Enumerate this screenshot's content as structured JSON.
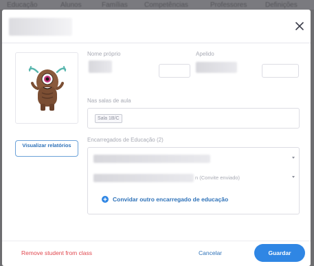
{
  "backdrop_nav": [
    "Educação",
    "Alunos",
    "Famílias",
    "Competências",
    "Professores",
    "Definições"
  ],
  "modal": {
    "close_icon": "close-icon",
    "avatar_icon": "monster-avatar-icon"
  },
  "form": {
    "first_name_label": "Nome próprio",
    "last_name_label": "Apelido",
    "classes_label": "Nas salas de aula",
    "class_chip": "Sala 1B/C",
    "guardians_label": "Encarregados de Educação (2)",
    "guardian_status": "n (Convite enviado)",
    "invite_label": "Convidar outro encarregado de educação"
  },
  "actions": {
    "view_reports": "Visualizar relatórios",
    "remove_student": "Remove student from class",
    "cancel": "Cancelar",
    "save": "Guardar"
  },
  "colors": {
    "accent": "#2f86e4",
    "link": "#2d71b8",
    "danger": "#e0474e"
  }
}
